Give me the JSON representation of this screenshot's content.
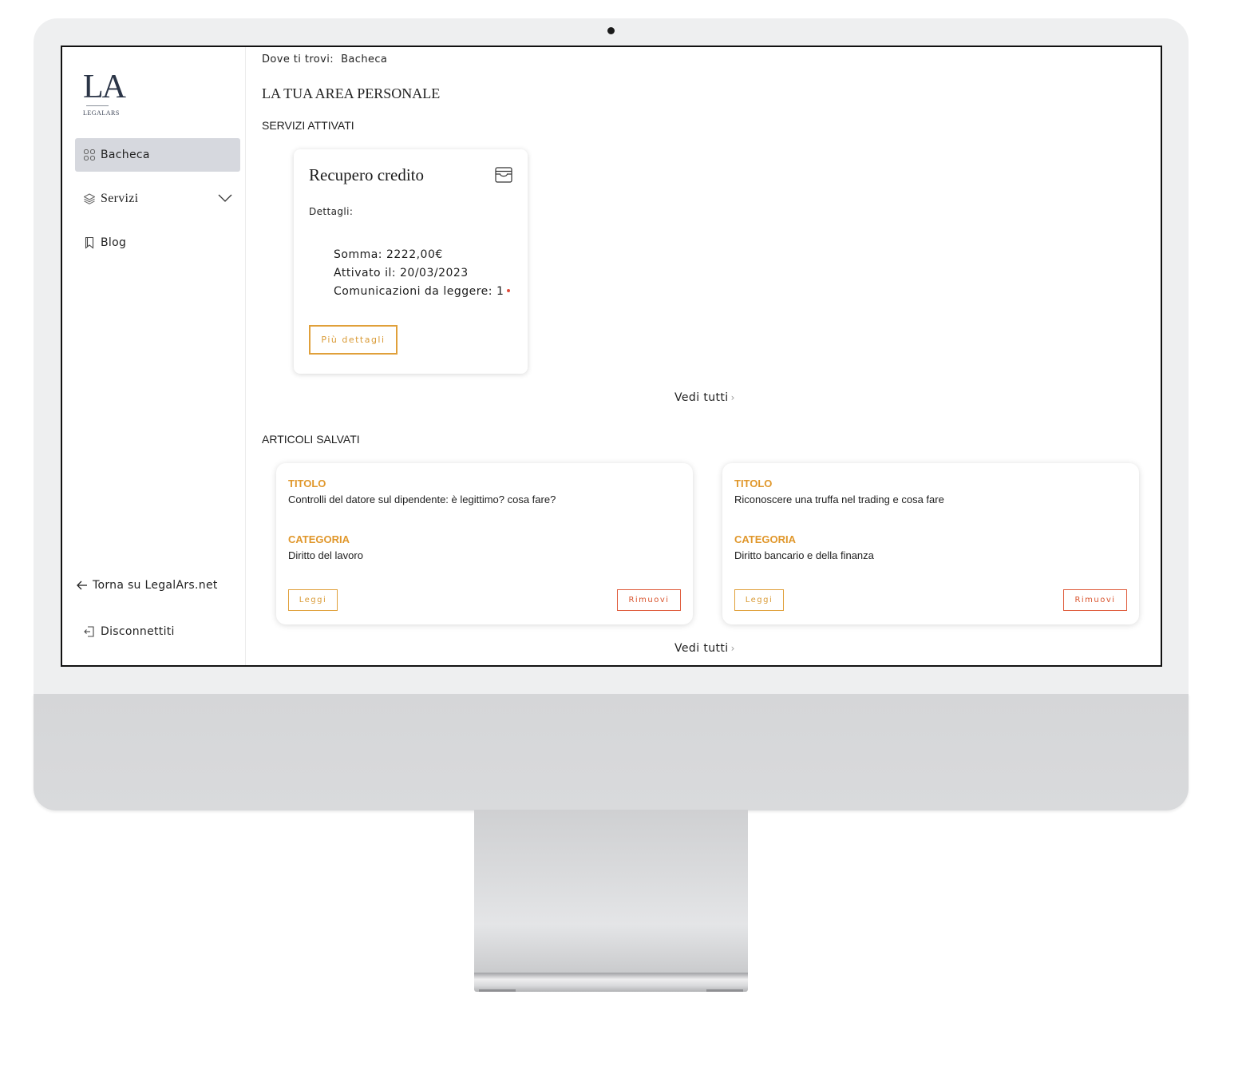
{
  "logo": {
    "mark": "LA",
    "text": "LEGALARS"
  },
  "sidebar": {
    "items": [
      {
        "label": "Bacheca",
        "icon": "grid-icon"
      },
      {
        "label": "Servizi",
        "icon": "layers-icon"
      },
      {
        "label": "Blog",
        "icon": "bookmark-icon"
      }
    ],
    "back_link": "Torna su LegalArs.net",
    "logout": "Disconnettiti"
  },
  "breadcrumb": {
    "prefix": "Dove ti trovi:",
    "current": "Bacheca"
  },
  "page_title": "LA TUA AREA PERSONALE",
  "services": {
    "section_title": "SERVIZI ATTIVATI",
    "card": {
      "title": "Recupero credito",
      "details_label": "Dettagli:",
      "amount": "Somma: 2222,00€",
      "activated": "Attivato il: 20/03/2023",
      "unread": "Comunicazioni da leggere: 1",
      "button": "Più dettagli"
    },
    "see_all": "Vedi tutti"
  },
  "articles": {
    "section_title": "ARTICOLI SALVATI",
    "title_label": "TITOLO",
    "category_label": "CATEGORIA",
    "read_label": "Leggi",
    "remove_label": "Rimuovi",
    "items": [
      {
        "title": "Controlli del datore sul dipendente: è legittimo? cosa fare?",
        "category": "Diritto del lavoro"
      },
      {
        "title": "Riconoscere una truffa nel trading e cosa fare",
        "category": "Diritto bancario e della finanza"
      }
    ],
    "see_all": "Vedi tutti"
  },
  "colors": {
    "accent_orange": "#e0a03a",
    "remove_red": "#df5a3a",
    "active_nav_bg": "#d6d8de",
    "unread_dot": "#e04b3a"
  }
}
